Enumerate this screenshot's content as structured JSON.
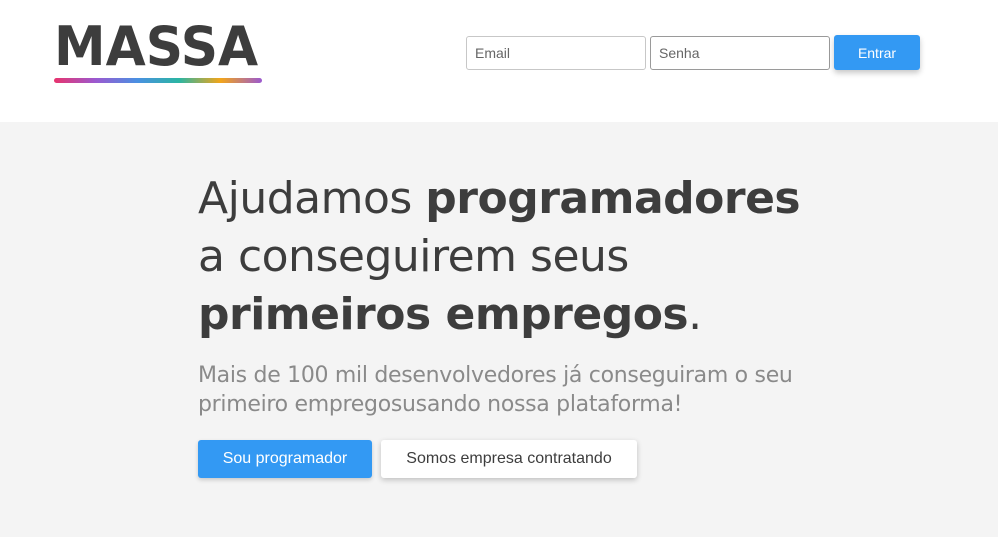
{
  "header": {
    "logo_text": "MASSA",
    "logo_gradient": [
      "#e8336d",
      "#9b59d0",
      "#4a90e2",
      "#2bb5a3",
      "#f2a51a",
      "#9b59d0"
    ],
    "login": {
      "email_placeholder": "Email",
      "senha_placeholder": "Senha",
      "submit_label": "Entrar"
    }
  },
  "hero": {
    "headline": {
      "part1": "Ajudamos ",
      "part1_bold": "programadores",
      "part2": "a conseguirem seus",
      "part3_bold": "primeiros empregos",
      "part3_end": "."
    },
    "subtitle_line1": "Mais de 100 mil desenvolvedores já conseguiram o seu",
    "subtitle_line2": "primeiro empregosusando nossa plataforma!",
    "primary_button": "Sou programador",
    "secondary_button": "Somos empresa contratando"
  },
  "colors": {
    "accent": "#3399f3",
    "text": "#3d3d3d",
    "hero_background": "#f4f4f4"
  }
}
